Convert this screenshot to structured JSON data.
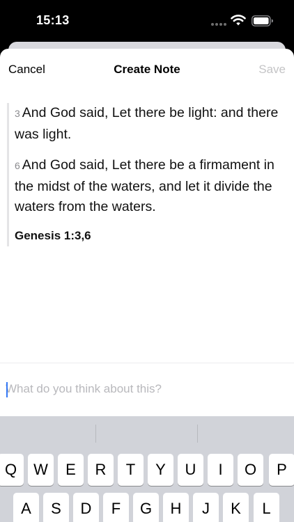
{
  "status_bar": {
    "time": "15:13"
  },
  "nav": {
    "cancel_label": "Cancel",
    "title": "Create Note",
    "save_label": "Save"
  },
  "verses": [
    {
      "num": "3",
      "text": "And God said, Let there be light: and there was light."
    },
    {
      "num": "6",
      "text": "And God said, Let there be a firmament in the midst of the waters, and let it divide the waters from the waters."
    }
  ],
  "reference": "Genesis 1:3,6",
  "note_input": {
    "value": "",
    "placeholder": "What do you think about this?"
  },
  "keyboard": {
    "row1": [
      "Q",
      "W",
      "E",
      "R",
      "T",
      "Y",
      "U",
      "I",
      "O",
      "P"
    ],
    "row2": [
      "A",
      "S",
      "D",
      "F",
      "G",
      "H",
      "J",
      "K",
      "L"
    ]
  },
  "colors": {
    "accent": "#3478f6",
    "disabled": "#c4c4c6",
    "keyboard_bg": "#d1d3d9"
  }
}
